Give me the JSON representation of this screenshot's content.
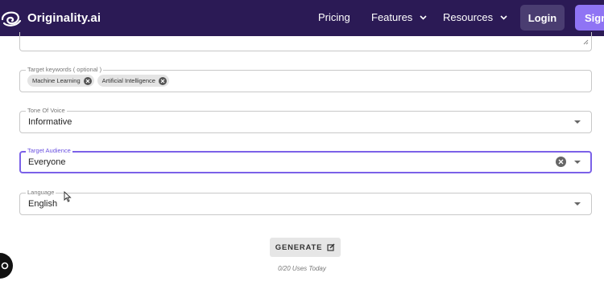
{
  "navbar": {
    "logo_text": "Originality.ai",
    "links": [
      {
        "label": "Pricing",
        "has_dropdown": false
      },
      {
        "label": "Features",
        "has_dropdown": true
      },
      {
        "label": "Resources",
        "has_dropdown": true
      }
    ],
    "login_label": "Login",
    "signup_label": "Sign"
  },
  "form": {
    "keywords": {
      "legend": "Target keywords ( optional )",
      "chips": [
        "Machine Learning",
        "Artificial Intelligence"
      ]
    },
    "tone": {
      "legend": "Tone Of Voice",
      "value": "Informative"
    },
    "audience": {
      "legend": "Target Audience",
      "value": "Everyone"
    },
    "language": {
      "legend": "Language",
      "value": "English"
    }
  },
  "generate": {
    "label": "GENERATE",
    "uses_text": "0/20 Uses Today"
  },
  "colors": {
    "navbar_bg": "#2b1a55",
    "login_bg": "#4a3d71",
    "signup_bg": "#8f74f4",
    "focus_border": "#7b61e8"
  }
}
